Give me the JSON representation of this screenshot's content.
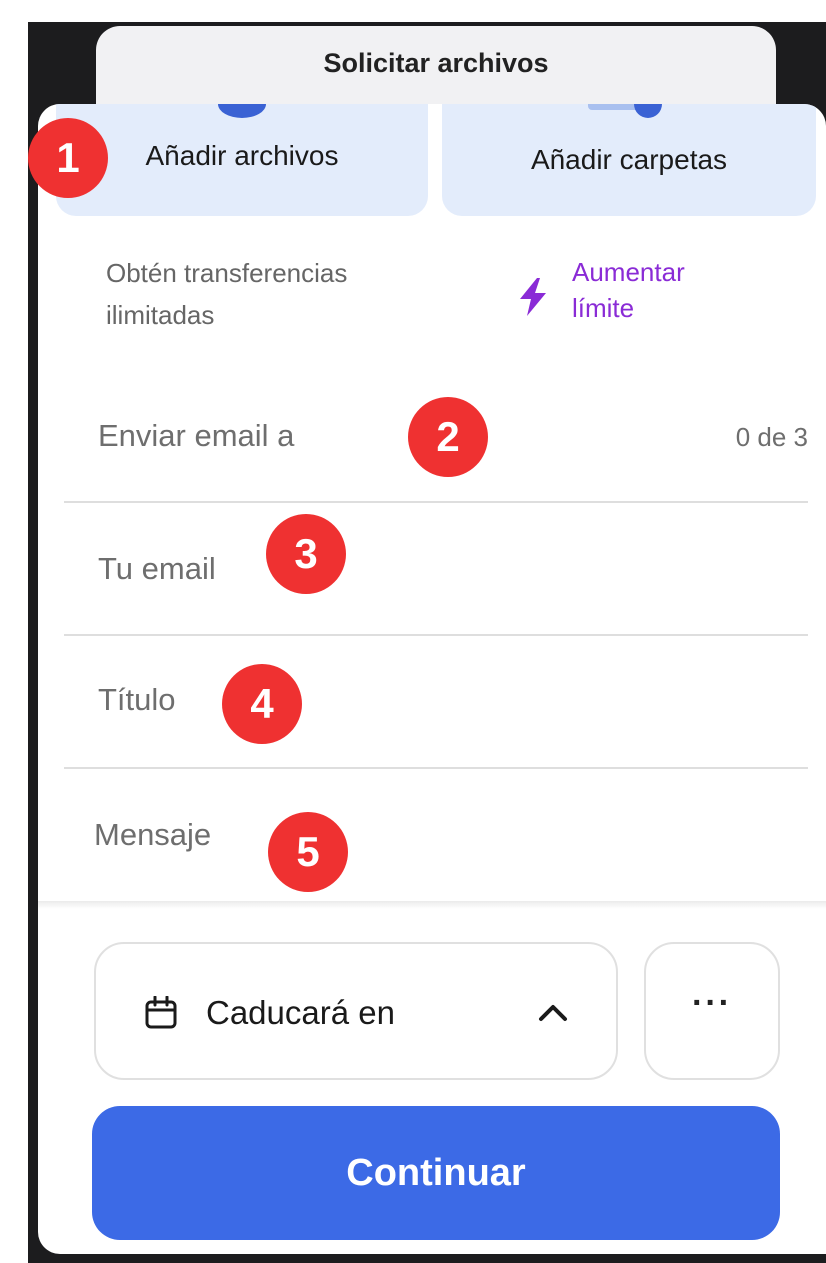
{
  "header": {
    "tab_title": "Solicitar archivos"
  },
  "upload": {
    "add_files_label": "Añadir archivos",
    "add_folders_label": "Añadir carpetas"
  },
  "promo": {
    "text": "Obtén transferencias ilimitadas",
    "link_label": "Aumentar límite"
  },
  "form": {
    "send_to_placeholder": "Enviar email a",
    "send_to_counter": "0 de 3",
    "your_email_placeholder": "Tu email",
    "title_placeholder": "Título",
    "message_placeholder": "Mensaje"
  },
  "footer": {
    "expiry_label": "Caducará en",
    "more_label": "···",
    "continue_label": "Continuar"
  },
  "markers": [
    "1",
    "2",
    "3",
    "4",
    "5"
  ],
  "colors": {
    "accent": "#3c6ae6",
    "upload_bg": "#e3ecfb",
    "promo_link": "#8a2bd6",
    "marker": "#ef3131"
  },
  "icons": {
    "promo": "lightning-icon",
    "expiry": "calendar-icon",
    "expiry_toggle": "chevron-up-icon"
  }
}
